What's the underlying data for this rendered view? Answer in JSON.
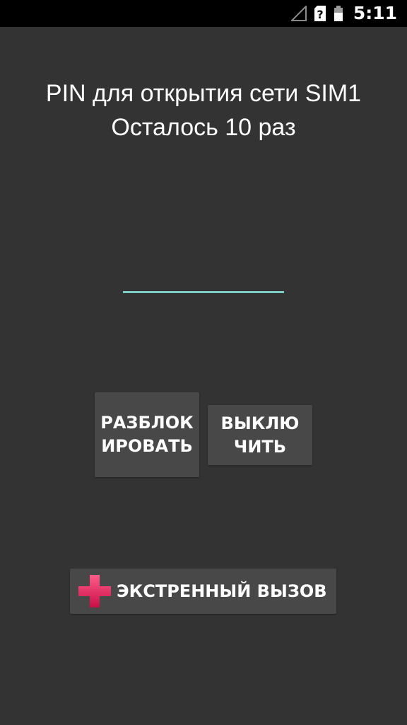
{
  "status_bar": {
    "time": "5:11",
    "icons": [
      "signal-icon",
      "sim-unknown-icon",
      "battery-icon"
    ],
    "sim_glyph": "?"
  },
  "prompt": {
    "line1": "PIN для открытия сети SIM1",
    "line2": "Осталось 10 раз"
  },
  "pin_field": {
    "value": "",
    "placeholder": ""
  },
  "buttons": {
    "unlock_label": "РАЗБЛОКИРОВАТЬ",
    "power_off_label": "ВЫКЛЮЧИТЬ",
    "emergency_label": "ЭКСТРЕННЫЙ ВЫЗОВ"
  },
  "colors": {
    "background": "#333333",
    "status_bar": "#000000",
    "accent_underline": "#80cbc4",
    "button": "#484848",
    "emergency_plus": "#e6195a"
  }
}
